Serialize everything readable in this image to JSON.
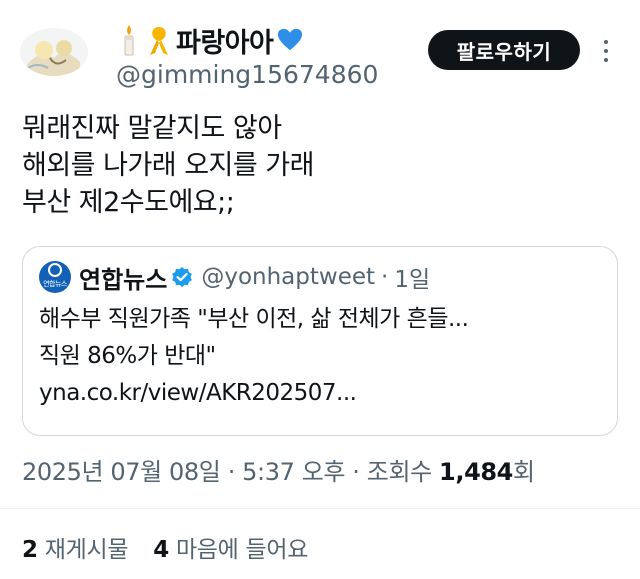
{
  "author": {
    "display_name": "파랑아아",
    "handle": "@gimming15674860",
    "emojis": [
      "candle-icon",
      "yellow-ribbon-icon",
      "blue-heart-icon"
    ]
  },
  "follow_button": {
    "label": "팔로우하기"
  },
  "more_icon": "more-vertical-icon",
  "tweet": {
    "lines": [
      "뭐래진짜 말같지도 않아",
      "해외를 나가래 오지를 가래",
      "부산 제2수도에요;;"
    ]
  },
  "quote": {
    "author": "연합뉴스",
    "avatar_text": "연합뉴스",
    "verified": true,
    "handle": "@yonhaptweet",
    "separator": "·",
    "time": "1일",
    "lines": [
      "해수부 직원가족 \"부산 이전, 삶 전체가 흔들...",
      "직원 86%가 반대\"",
      "yna.co.kr/view/AKR202507..."
    ]
  },
  "meta": {
    "date": "2025년 07월 08일",
    "separator": "·",
    "time": "5:37 오후",
    "views_label": "조회수",
    "views_count": "1,484",
    "views_unit": "회"
  },
  "stats": {
    "reposts_count": "2",
    "reposts_label": "재게시물",
    "likes_count": "4",
    "likes_label": "마음에 들어요"
  },
  "colors": {
    "text": "#0f1419",
    "secondary": "#536471",
    "border": "#cfd9de",
    "follow_bg": "#0f1419",
    "verified": "#1d9bf0",
    "blue_heart": "#2f8fe8",
    "yonhap_blue": "#1361b6"
  }
}
